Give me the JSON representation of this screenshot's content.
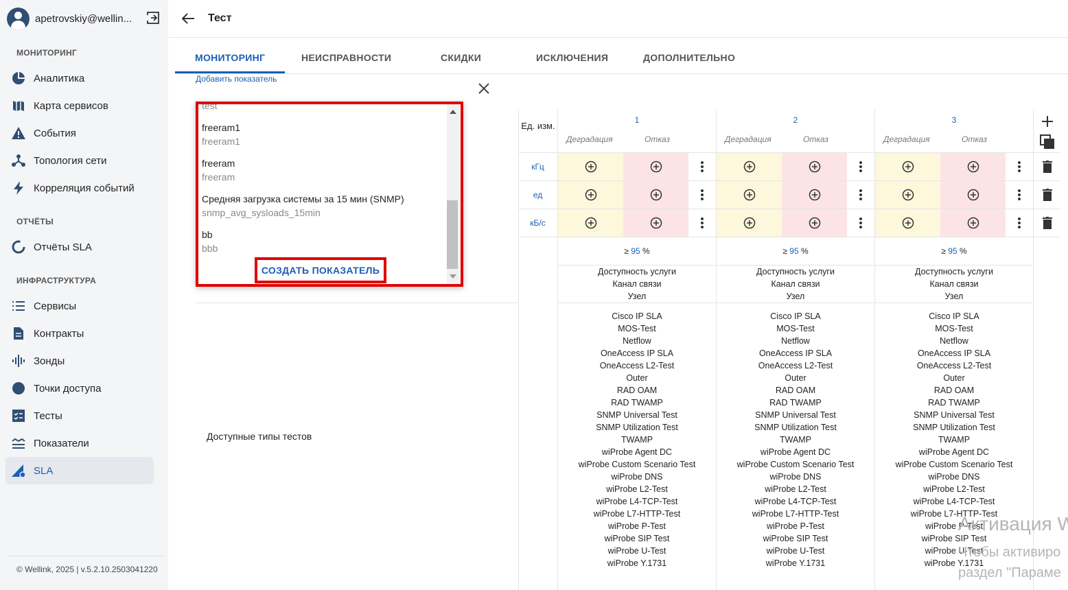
{
  "user": {
    "name": "apetrovskiy@wellin..."
  },
  "sidebar": {
    "sections": [
      {
        "label": "МОНИТОРИНГ"
      },
      {
        "label": "ОТЧЁТЫ"
      },
      {
        "label": "ИНФРАСТРУКТУРА"
      }
    ],
    "items": [
      {
        "label": "Аналитика",
        "icon": "pie-chart-icon"
      },
      {
        "label": "Карта сервисов",
        "icon": "map-icon"
      },
      {
        "label": "События",
        "icon": "warning-icon"
      },
      {
        "label": "Топология сети",
        "icon": "topology-icon"
      },
      {
        "label": "Корреляция событий",
        "icon": "bolt-icon"
      },
      {
        "label": "Отчёты SLA",
        "icon": "ring-icon"
      },
      {
        "label": "Сервисы",
        "icon": "list-icon"
      },
      {
        "label": "Контракты",
        "icon": "document-icon"
      },
      {
        "label": "Зонды",
        "icon": "waveform-icon"
      },
      {
        "label": "Точки доступа",
        "icon": "circle-icon"
      },
      {
        "label": "Тесты",
        "icon": "checklist-icon"
      },
      {
        "label": "Показатели",
        "icon": "indicators-icon"
      },
      {
        "label": "SLA",
        "icon": "sla-icon"
      }
    ],
    "footer": "© Wellink, 2025 | v.5.2.10.2503041220"
  },
  "header": {
    "title": "Тест"
  },
  "tabs": [
    "МОНИТОРИНГ",
    "НЕИСПРАВНОСТИ",
    "СКИДКИ",
    "ИСКЛЮЧЕНИЯ",
    "ДОПОЛНИТЕЛЬНО"
  ],
  "add_link": "Добавить показатель",
  "popup": {
    "items": [
      {
        "title": "",
        "sub": "test"
      },
      {
        "title": "freeram1",
        "sub": "freeram1"
      },
      {
        "title": "freeram",
        "sub": "freeram"
      },
      {
        "title": "Средняя загрузка системы за 15 мин (SNMP)",
        "sub": "snmp_avg_sysloads_15min"
      },
      {
        "title": "bb",
        "sub": "bbb"
      }
    ],
    "create_label": "СОЗДАТЬ ПОКАЗАТЕЛЬ"
  },
  "table": {
    "unit_header": "Ед. изм.",
    "columns": [
      {
        "num": "1"
      },
      {
        "num": "2"
      },
      {
        "num": "3"
      }
    ],
    "degr": "Деградация",
    "fail": "Отказ",
    "units": [
      "кГц",
      "ед",
      "кБ/с"
    ],
    "pct_prefix": "≥",
    "pct_value": "95",
    "pct_suffix": "%",
    "scopes": [
      "Доступность услуги",
      "Канал связи",
      "Узел"
    ],
    "tests_label": "Доступные типы тестов",
    "tests": [
      "Cisco IP SLA",
      "MOS-Test",
      "Netflow",
      "OneAccess IP SLA",
      "OneAccess L2-Test",
      "Outer",
      "RAD OAM",
      "RAD TWAMP",
      "SNMP Universal Test",
      "SNMP Utilization Test",
      "TWAMP",
      "wiProbe Agent DC",
      "wiProbe Custom Scenario Test",
      "wiProbe DNS",
      "wiProbe L2-Test",
      "wiProbe L4-TCP-Test",
      "wiProbe L7-HTTP-Test",
      "wiProbe P-Test",
      "wiProbe SIP Test",
      "wiProbe U-Test",
      "wiProbe Y.1731"
    ]
  },
  "watermark": {
    "line1": "Активация W",
    "line2": "Чтобы активиро",
    "line3": "раздел \"Параме"
  }
}
